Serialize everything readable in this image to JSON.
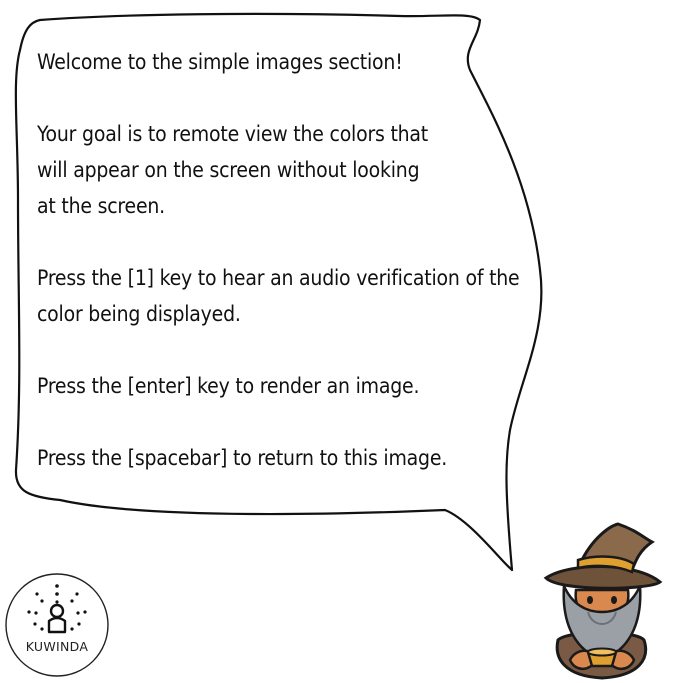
{
  "bubble": {
    "welcome": "Welcome to the simple images section!",
    "goal_lines": [
      "Your goal is to remote view the colors that",
      "will appear on the screen without looking",
      "at the screen."
    ],
    "audio_lines": [
      "Press the [1] key to hear an audio verification of the",
      "color being displayed."
    ],
    "enter_line": "Press the [enter] key to render an image.",
    "space_line": "Press the [spacebar] to return to this image."
  },
  "logo": {
    "text": "KUWINDA",
    "icon": "kuwinda-logo-icon"
  },
  "wizard": {
    "icon": "wizard-character-icon"
  },
  "colors": {
    "outline": "#111111",
    "hat": "#8a6a4a",
    "hatband": "#e0a030",
    "beard": "#9aa0a6",
    "skin": "#d9884e",
    "robe": "#7a5a45"
  }
}
